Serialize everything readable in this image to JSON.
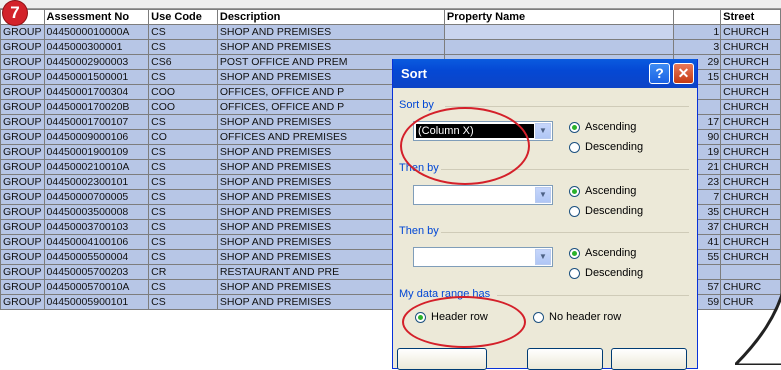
{
  "step_number": "7",
  "sheet": {
    "headers": [
      "",
      "Assessment No",
      "Use Code",
      "Description",
      "Property Name",
      "",
      "Street"
    ],
    "rows": [
      [
        "GROUP",
        "0445000010000A",
        "CS",
        "SHOP AND PREMISES",
        "",
        "1",
        "CHURCH"
      ],
      [
        "GROUP",
        "0445000300001",
        "CS",
        "SHOP AND PREMISES",
        "",
        "3",
        "CHURCH"
      ],
      [
        "GROUP",
        "04450002900003",
        "CS6",
        "POST OFFICE AND PREM",
        "",
        "29",
        "CHURCH"
      ],
      [
        "GROUP",
        "04450001500001",
        "CS",
        "SHOP AND PREMISES",
        "",
        "15",
        "CHURCH"
      ],
      [
        "GROUP",
        "04450001700304",
        "COO",
        "OFFICES, OFFICE AND P",
        "",
        "",
        "CHURCH"
      ],
      [
        "GROUP",
        "0445000170020B",
        "COO",
        "OFFICES, OFFICE AND P",
        "",
        "",
        "CHURCH"
      ],
      [
        "GROUP",
        "04450001700107",
        "CS",
        "SHOP AND PREMISES",
        "",
        "17",
        "CHURCH"
      ],
      [
        "GROUP",
        "04450009000106",
        "CO",
        "OFFICES AND PREMISES",
        "",
        "90",
        "CHURCH"
      ],
      [
        "GROUP",
        "04450001900109",
        "CS",
        "SHOP AND PREMISES",
        "",
        "19",
        "CHURCH"
      ],
      [
        "GROUP",
        "0445000210010A",
        "CS",
        "SHOP AND PREMISES",
        "",
        "21",
        "CHURCH"
      ],
      [
        "GROUP",
        "04450002300101",
        "CS",
        "SHOP AND PREMISES",
        "",
        "23",
        "CHURCH"
      ],
      [
        "GROUP",
        "04450000700005",
        "CS",
        "SHOP AND PREMISES",
        "",
        "7",
        "CHURCH"
      ],
      [
        "GROUP",
        "04450003500008",
        "CS",
        "SHOP AND PREMISES",
        "",
        "35",
        "CHURCH"
      ],
      [
        "GROUP",
        "04450003700103",
        "CS",
        "SHOP AND PREMISES",
        "",
        "37",
        "CHURCH"
      ],
      [
        "GROUP",
        "04450004100106",
        "CS",
        "SHOP AND PREMISES",
        "",
        "41",
        "CHURCH"
      ],
      [
        "GROUP",
        "04450005500004",
        "CS",
        "SHOP AND PREMISES",
        "",
        "55",
        "CHURCH"
      ],
      [
        "GROUP",
        "04450005700203",
        "CR",
        "RESTAURANT AND PRE",
        "",
        "",
        ""
      ],
      [
        "GROUP",
        "0445000570010A",
        "CS",
        "SHOP AND PREMISES",
        "",
        "57",
        "CHURC"
      ],
      [
        "GROUP",
        "04450005900101",
        "CS",
        "SHOP AND PREMISES",
        "",
        "59",
        "CHUR"
      ]
    ]
  },
  "dialog": {
    "title": "Sort",
    "help_label": "?",
    "close_label": "✕",
    "sort_by_label": "Sort by",
    "sort_by_value": "(Column X)",
    "then_by_1_label": "Then by",
    "then_by_2_label": "Then by",
    "ascending_label": "Ascending",
    "descending_label": "Descending",
    "range_label": "My data range has",
    "header_row_label": "Header row",
    "no_header_row_label": "No header row"
  },
  "colors": {
    "highlight": "#d4202a",
    "selection": "#b7c6e6",
    "title_bar": "#0548d4"
  }
}
